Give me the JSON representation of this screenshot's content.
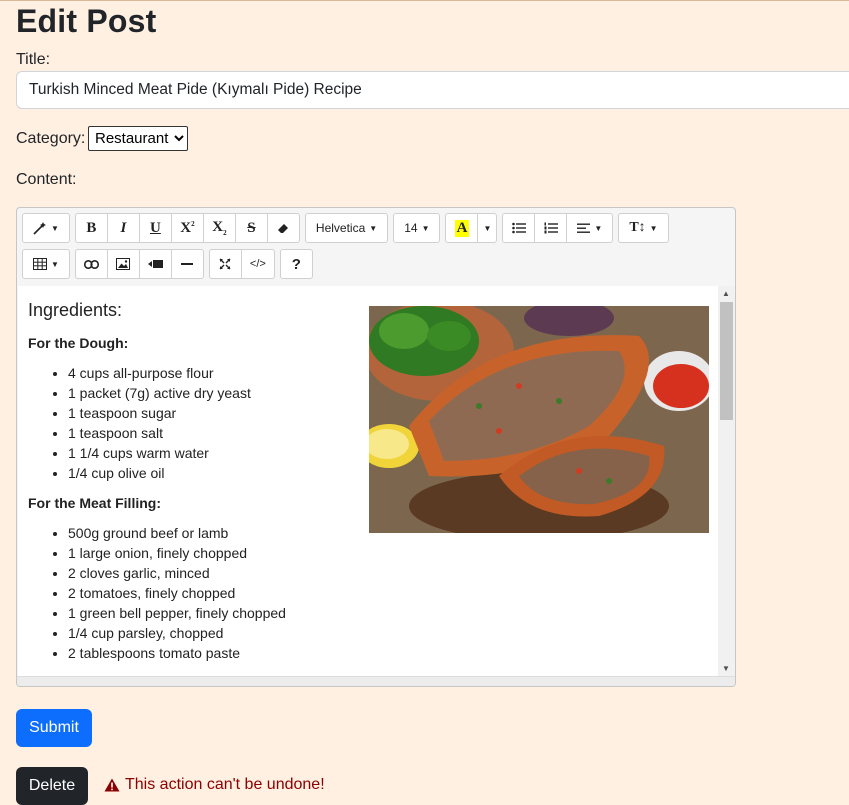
{
  "page": {
    "title": "Edit Post"
  },
  "form": {
    "title_label": "Title:",
    "title_value": "Turkish Minced Meat Pide (Kıymalı Pide) Recipe",
    "category_label": "Category:",
    "category_selected": "Restaurant",
    "content_label": "Content:"
  },
  "toolbar": {
    "font_name": "Helvetica",
    "font_size": "14",
    "color_letter": "A",
    "highlight_color": "#ffff00"
  },
  "content": {
    "heading": "Ingredients:",
    "dough_title": "For the Dough:",
    "dough_items": [
      "4 cups all-purpose flour",
      "1 packet (7g) active dry yeast",
      "1 teaspoon sugar",
      "1 teaspoon salt",
      "1 1/4 cups warm water",
      "1/4 cup olive oil"
    ],
    "filling_title": "For the Meat Filling:",
    "filling_items": [
      "500g ground beef or lamb",
      "1 large onion, finely chopped",
      "2 cloves garlic, minced",
      "2 tomatoes, finely chopped",
      "1 green bell pepper, finely chopped",
      "1/4 cup parsley, chopped",
      "2 tablespoons tomato paste"
    ]
  },
  "actions": {
    "submit_label": "Submit",
    "delete_label": "Delete",
    "warning_text": "This action can't be undone!"
  },
  "colors": {
    "page_bg": "#fff0e1",
    "primary": "#0d6efd",
    "dark": "#212529",
    "warning": "#8b0000"
  }
}
